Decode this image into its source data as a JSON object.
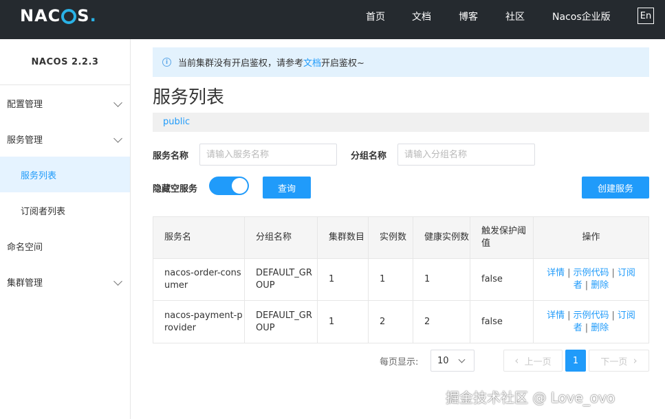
{
  "header": {
    "logo_text_left": "NAC",
    "logo_text_right": "S",
    "logo_dot": ".",
    "nav_items": [
      "首页",
      "文档",
      "博客",
      "社区",
      "Nacos企业版"
    ],
    "lang_label": "En"
  },
  "sidebar": {
    "version": "NACOS 2.2.3",
    "items": [
      {
        "label": "配置管理"
      },
      {
        "label": "服务管理"
      },
      {
        "label": "服务列表"
      },
      {
        "label": "订阅者列表"
      },
      {
        "label": "命名空间"
      },
      {
        "label": "集群管理"
      }
    ]
  },
  "notice": {
    "before": "当前集群没有开启鉴权，请参考",
    "link": "文档",
    "after": "开启鉴权~"
  },
  "main": {
    "title": "服务列表",
    "namespace": "public",
    "service_name_label": "服务名称",
    "service_name_placeholder": "请输入服务名称",
    "group_name_label": "分组名称",
    "group_name_placeholder": "请输入分组名称",
    "hide_empty_label": "隐藏空服务",
    "hide_empty_on": true,
    "query_button": "查询",
    "create_button": "创建服务"
  },
  "table": {
    "headers": [
      "服务名",
      "分组名称",
      "集群数目",
      "实例数",
      "健康实例数",
      "触发保护阈值",
      "操作"
    ],
    "rows": [
      {
        "service": "nacos-order-consumer",
        "group": "DEFAULT_GROUP",
        "clusters": "1",
        "instances": "1",
        "healthy": "1",
        "protect": "false"
      },
      {
        "service": "nacos-payment-provider",
        "group": "DEFAULT_GROUP",
        "clusters": "1",
        "instances": "2",
        "healthy": "2",
        "protect": "false"
      }
    ],
    "ops": {
      "detail": "详情",
      "sample": "示例代码",
      "subscriber": "订阅者",
      "delete": "删除",
      "sep": "|"
    }
  },
  "pagination": {
    "page_size_label": "每页显示:",
    "page_size": "10",
    "prev": "上一页",
    "next": "下一页",
    "current": "1"
  },
  "watermark": "掘金技术社区 @ Love_ovo",
  "colors": {
    "primary": "#209bfa",
    "topbar": "#252a2f",
    "notice_bg": "#e3f2fd"
  }
}
